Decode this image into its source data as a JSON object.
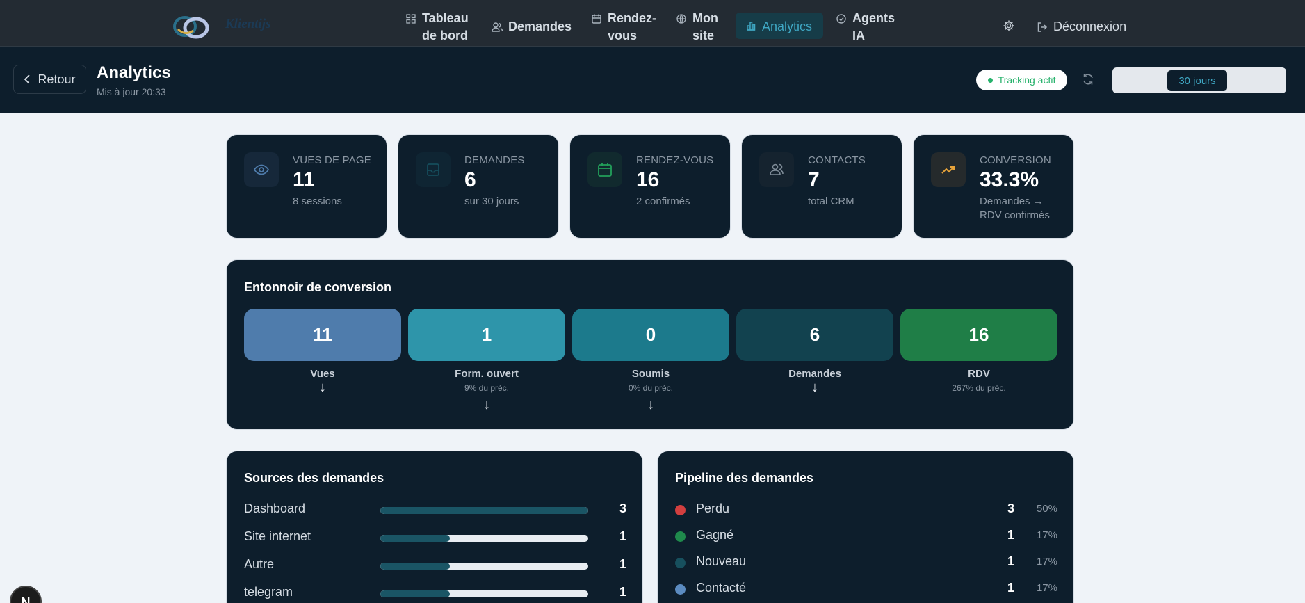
{
  "nav": {
    "brand": "Klientijs",
    "items": [
      {
        "line1": "Tableau",
        "line2": "de bord",
        "icon": "grid-icon"
      },
      {
        "label": "Demandes",
        "icon": "users-icon"
      },
      {
        "line1": "Rendez-",
        "line2": "vous",
        "icon": "calendar-icon"
      },
      {
        "line1": "Mon",
        "line2": "site",
        "icon": "globe-icon"
      },
      {
        "label": "Analytics",
        "icon": "bar-chart-icon"
      },
      {
        "line1": "Agents",
        "line2": "IA",
        "icon": "bot-icon"
      }
    ],
    "logout": "Déconnexion"
  },
  "header": {
    "back": "Retour",
    "title": "Analytics",
    "subtitle": "Mis à jour 20:33",
    "tracking": "Tracking actif",
    "range_selected": "30 jours"
  },
  "stats": [
    {
      "label": "Vues de page",
      "value": "11",
      "sub": "8 sessions",
      "icon": "eye-icon",
      "color": "#4f7cac"
    },
    {
      "label": "Demandes",
      "value": "6",
      "sub": "sur 30 jours",
      "icon": "inbox-icon",
      "color": "#164d5c"
    },
    {
      "label": "Rendez-vous",
      "value": "16",
      "sub": "2 confirmés",
      "icon": "calendar-icon",
      "color": "#22a05a"
    },
    {
      "label": "Contacts",
      "value": "7",
      "sub": "total CRM",
      "icon": "users-icon",
      "color": "#7f8c98"
    },
    {
      "label": "Conversion",
      "value": "33.3%",
      "sub": "Demandes → RDV confirmés",
      "icon": "trending-up-icon",
      "color": "#e7a33a"
    }
  ],
  "funnel": {
    "title": "Entonnoir de conversion",
    "steps": [
      {
        "value": "11",
        "name": "Vues",
        "pct": "",
        "color": "#4f7cac"
      },
      {
        "value": "1",
        "name": "Form. ouvert",
        "pct": "9% du préc.",
        "color": "#2e95aa"
      },
      {
        "value": "0",
        "name": "Soumis",
        "pct": "0% du préc.",
        "color": "#1c7a8c"
      },
      {
        "value": "6",
        "name": "Demandes",
        "pct": "",
        "color": "#12424f"
      },
      {
        "value": "16",
        "name": "RDV",
        "pct": "267% du préc.",
        "color": "#1f7e47"
      }
    ]
  },
  "sources": {
    "title": "Sources des demandes",
    "rows": [
      {
        "name": "Dashboard",
        "count": "3",
        "share": 1.0
      },
      {
        "name": "Site internet",
        "count": "1",
        "share": 0.333
      },
      {
        "name": "Autre",
        "count": "1",
        "share": 0.333
      },
      {
        "name": "telegram",
        "count": "1",
        "share": 0.333
      }
    ]
  },
  "pipeline": {
    "title": "Pipeline des demandes",
    "rows": [
      {
        "name": "Perdu",
        "count": "3",
        "pct": "50%",
        "color": "#d23f3f"
      },
      {
        "name": "Gagné",
        "count": "1",
        "pct": "17%",
        "color": "#1f8a4c"
      },
      {
        "name": "Nouveau",
        "count": "1",
        "pct": "17%",
        "color": "#17505e"
      },
      {
        "name": "Contacté",
        "count": "1",
        "pct": "17%",
        "color": "#5b8bc0"
      }
    ]
  },
  "badge": "N"
}
